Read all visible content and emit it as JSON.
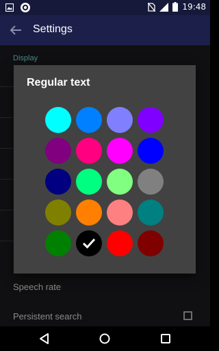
{
  "status_bar": {
    "time": "19:48",
    "icons": [
      "image-notification-icon",
      "circle-notification-icon",
      "no-sim-icon",
      "signal-icon",
      "battery-icon"
    ]
  },
  "app_bar": {
    "title": "Settings",
    "back_icon": "arrow-left-icon"
  },
  "settings_list": {
    "section": "Display",
    "items": [
      {
        "label": "Speech rate"
      },
      {
        "label": "Persistent search",
        "checked": false
      }
    ]
  },
  "dialog": {
    "title": "Regular text",
    "selected_index": 17,
    "swatches": [
      {
        "name": "cyan",
        "color": "#00ffff"
      },
      {
        "name": "azure",
        "color": "#0080ff"
      },
      {
        "name": "periwinkle",
        "color": "#8080ff"
      },
      {
        "name": "violet",
        "color": "#8000ff"
      },
      {
        "name": "purple",
        "color": "#800080"
      },
      {
        "name": "pink",
        "color": "#ff0080"
      },
      {
        "name": "magenta",
        "color": "#ff00ff"
      },
      {
        "name": "blue",
        "color": "#0000ff"
      },
      {
        "name": "navy",
        "color": "#000080"
      },
      {
        "name": "spring-green",
        "color": "#00ff80"
      },
      {
        "name": "light-green",
        "color": "#80ff80"
      },
      {
        "name": "gray",
        "color": "#808080"
      },
      {
        "name": "olive",
        "color": "#808000"
      },
      {
        "name": "orange",
        "color": "#ff8000"
      },
      {
        "name": "salmon",
        "color": "#ff8080"
      },
      {
        "name": "teal",
        "color": "#008080"
      },
      {
        "name": "green",
        "color": "#008000"
      },
      {
        "name": "black",
        "color": "#000000"
      },
      {
        "name": "red",
        "color": "#ff0000"
      },
      {
        "name": "maroon",
        "color": "#800000"
      }
    ]
  },
  "nav_bar": {
    "buttons": [
      "back-triangle-icon",
      "home-circle-icon",
      "recents-square-icon"
    ]
  }
}
